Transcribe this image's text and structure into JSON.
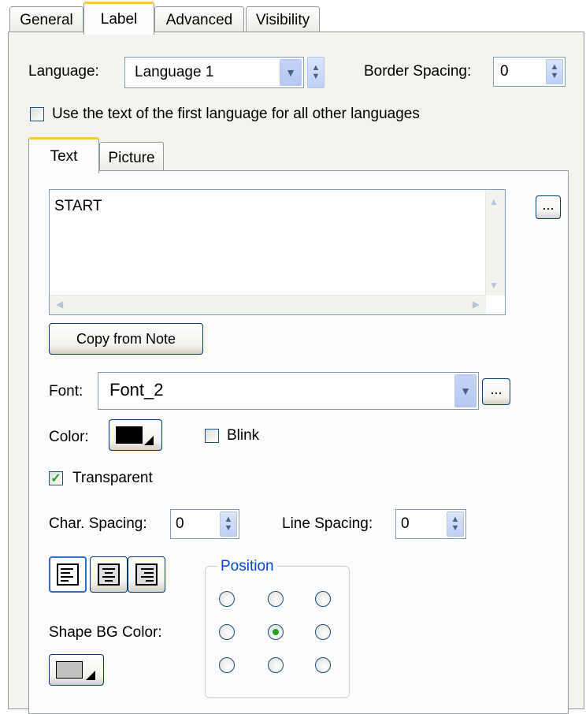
{
  "tabs": [
    "General",
    "Label",
    "Advanced",
    "Visibility"
  ],
  "language": {
    "label": "Language:",
    "value": "Language 1"
  },
  "border_spacing": {
    "label": "Border Spacing:",
    "value": "0"
  },
  "use_first_language": {
    "label": "Use the text of the first language for all other languages",
    "checked": false
  },
  "inner_tabs": [
    "Text",
    "Picture"
  ],
  "text_area": {
    "value": "START"
  },
  "ellipsis": "...",
  "copy_from_note": "Copy from Note",
  "font": {
    "label": "Font:",
    "value": "Font_2"
  },
  "color": {
    "label": "Color:",
    "value_hex": "#000000"
  },
  "blink": {
    "label": "Blink",
    "checked": false
  },
  "transparent": {
    "label": "Transparent",
    "checked": true
  },
  "char_spacing": {
    "label": "Char. Spacing:",
    "value": "0"
  },
  "line_spacing": {
    "label": "Line Spacing:",
    "value": "0"
  },
  "alignment_icons": [
    "align-left-icon",
    "align-center-icon",
    "align-right-icon"
  ],
  "position": {
    "label": "Position",
    "selected": "middle-center"
  },
  "shape_bg_color": {
    "label": "Shape BG Color:",
    "value_hex": "#c0c0c0"
  },
  "colors": {
    "tab_accent": "#ffc83c",
    "position_label": "#0046d5",
    "check_green": "#21a121"
  }
}
